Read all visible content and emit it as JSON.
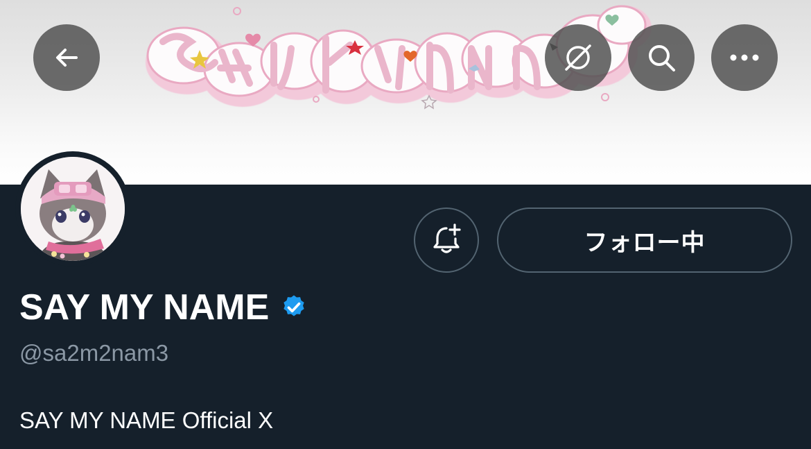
{
  "header": {
    "back_icon": "arrow-left-icon",
    "grok_icon": "grok-icon",
    "search_icon": "search-icon",
    "more_icon": "more-horizontal-icon",
    "banner_title": "SAY MY NAME"
  },
  "profile": {
    "display_name": "SAY MY NAME",
    "verified": true,
    "verified_color": "#1d9bf0",
    "handle": "@sa2m2nam3",
    "bio": "SAY MY NAME Official X"
  },
  "actions": {
    "bell_icon": "bell-plus-icon",
    "follow_label": "フォロー中"
  },
  "colors": {
    "background": "#15202b",
    "button_border": "#536471",
    "handle_text": "#8b98a5"
  }
}
